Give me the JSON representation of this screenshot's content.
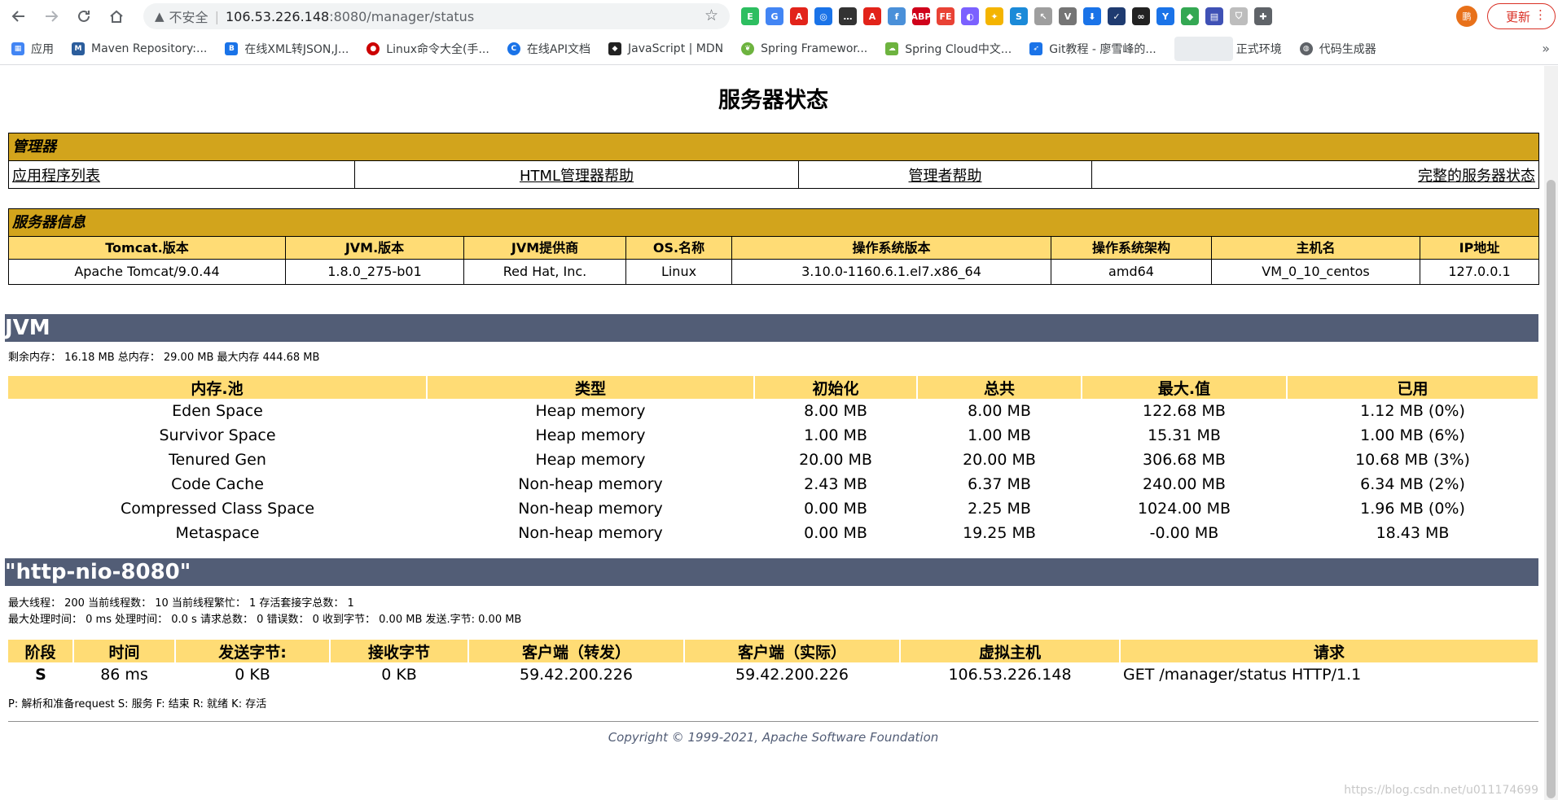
{
  "browser": {
    "insecure_label": "不安全",
    "url_host": "106.53.226.148",
    "url_path": ":8080/manager/status",
    "update_label": "更新",
    "avatar_text": "鹏",
    "bookmarks": [
      {
        "label": "应用",
        "icon": "apps-grid-icon",
        "color": "#4285f4"
      },
      {
        "label": "Maven Repository:...",
        "icon": "maven-icon",
        "color": "#2b5d9c"
      },
      {
        "label": "在线XML转JSON,J...",
        "icon": "bejson-icon",
        "color": "#1a73e8"
      },
      {
        "label": "Linux命令大全(手...",
        "icon": "redhat-icon",
        "color": "#cc0000"
      },
      {
        "label": "在线API文档",
        "icon": "api-doc-icon",
        "color": "#1a73e8"
      },
      {
        "label": "JavaScript | MDN",
        "icon": "mdn-icon",
        "color": "#222222"
      },
      {
        "label": "Spring Framewor...",
        "icon": "spring-icon",
        "color": "#6db33f"
      },
      {
        "label": "Spring Cloud中文...",
        "icon": "spring-cloud-icon",
        "color": "#6db33f"
      },
      {
        "label": "Git教程 - 廖雪峰的...",
        "icon": "rocket-icon",
        "color": "#1a73e8"
      },
      {
        "label": "正式环境",
        "icon": "blurred-icon",
        "color": "#cccccc"
      },
      {
        "label": "代码生成器",
        "icon": "globe-icon",
        "color": "#5f6368"
      }
    ]
  },
  "page": {
    "title": "服务器状态",
    "manager": {
      "section_title": "管理器",
      "links": [
        "应用程序列表",
        "HTML管理器帮助",
        "管理者帮助",
        "完整的服务器状态"
      ]
    },
    "server_info": {
      "section_title": "服务器信息",
      "headers": [
        "Tomcat.版本",
        "JVM.版本",
        "JVM提供商",
        "OS.名称",
        "操作系统版本",
        "操作系统架构",
        "主机名",
        "IP地址"
      ],
      "values": [
        "Apache Tomcat/9.0.44",
        "1.8.0_275-b01",
        "Red Hat, Inc.",
        "Linux",
        "3.10.0-1160.6.1.el7.x86_64",
        "amd64",
        "VM_0_10_centos",
        "127.0.0.1"
      ]
    },
    "jvm": {
      "banner": "JVM",
      "memory_summary": "剩余内存： 16.18 MB 总内存： 29.00 MB 最大内存 444.68 MB",
      "headers": [
        "内存.池",
        "类型",
        "初始化",
        "总共",
        "最大.值",
        "已用"
      ],
      "rows": [
        [
          "Eden Space",
          "Heap memory",
          "8.00 MB",
          "8.00 MB",
          "122.68 MB",
          "1.12 MB (0%)"
        ],
        [
          "Survivor Space",
          "Heap memory",
          "1.00 MB",
          "1.00 MB",
          "15.31 MB",
          "1.00 MB (6%)"
        ],
        [
          "Tenured Gen",
          "Heap memory",
          "20.00 MB",
          "20.00 MB",
          "306.68 MB",
          "10.68 MB (3%)"
        ],
        [
          "Code Cache",
          "Non-heap memory",
          "2.43 MB",
          "6.37 MB",
          "240.00 MB",
          "6.34 MB (2%)"
        ],
        [
          "Compressed Class Space",
          "Non-heap memory",
          "0.00 MB",
          "2.25 MB",
          "1024.00 MB",
          "1.96 MB (0%)"
        ],
        [
          "Metaspace",
          "Non-heap memory",
          "0.00 MB",
          "19.25 MB",
          "-0.00 MB",
          "18.43 MB"
        ]
      ]
    },
    "connector": {
      "banner": "\"http-nio-8080\"",
      "thread_info": "最大线程： 200 当前线程数： 10 当前线程繁忙： 1 存活套接字总数： 1",
      "request_info": "最大处理时间： 0 ms 处理时间： 0.0 s 请求总数： 0 错误数： 0 收到字节： 0.00 MB 发送.字节: 0.00 MB",
      "headers": [
        "阶段",
        "时间",
        "发送字节:",
        "接收字节",
        "客户端（转发）",
        "客户端（实际）",
        "虚拟主机",
        "请求"
      ],
      "rows": [
        [
          "S",
          "86 ms",
          "0 KB",
          "0 KB",
          "59.42.200.226",
          "59.42.200.226",
          "106.53.226.148",
          "GET /manager/status HTTP/1.1"
        ]
      ],
      "legend": "P: 解析和准备request S: 服务 F: 结束 R: 就绪 K: 存活"
    },
    "footer": {
      "copyright": "Copyright © 1999-2021, Apache Software Foundation",
      "watermark": "https://blog.csdn.net/u011174699"
    }
  },
  "colors": {
    "section_title_bg": "#d2a41c",
    "header_bg": "#ffdc75",
    "banner_bg": "#525d76"
  }
}
